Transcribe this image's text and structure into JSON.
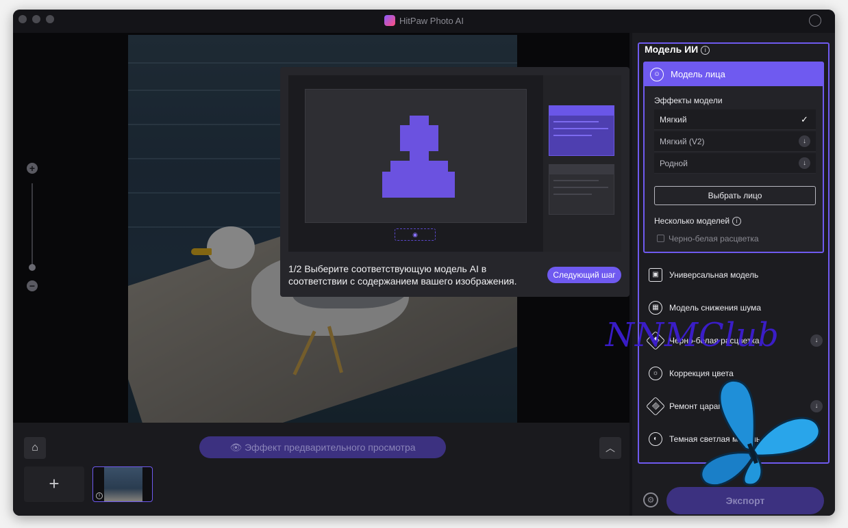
{
  "app": {
    "title": "HitPaw Photo AI"
  },
  "tour": {
    "text": "1/2 Выберите соответствующую модель AI в соответствии с содержанием вашего изображения.",
    "next_label": "Следующий шаг"
  },
  "bottom": {
    "preview_effect": "Эффект предварительного просмотра",
    "add": "+"
  },
  "panel": {
    "section_title": "Модель ИИ",
    "face_model": {
      "title": "Модель лица",
      "effects_label": "Эффекты модели",
      "options": [
        {
          "label": "Мягкий",
          "state": "selected"
        },
        {
          "label": "Мягкий (V2)",
          "state": "download"
        },
        {
          "label": "Родной",
          "state": "download"
        }
      ],
      "choose_face": "Выбрать лицо",
      "multi_label": "Несколько моделей",
      "bw_checkbox": "Черно-белая расцветка"
    },
    "models": [
      {
        "label": "Универсальная модель",
        "icon": "image-icon",
        "download": false
      },
      {
        "label": "Модель снижения шума",
        "icon": "noise-icon",
        "download": false
      },
      {
        "label": "Черно-белая расцветка",
        "icon": "colorize-icon",
        "download": true
      },
      {
        "label": "Коррекция цвета",
        "icon": "sun-icon",
        "download": false
      },
      {
        "label": "Ремонт царапин",
        "icon": "bandage-icon",
        "download": true
      },
      {
        "label": "Темная светлая модель",
        "icon": "contrast-icon",
        "download": false
      }
    ],
    "export_label": "Экспорт"
  },
  "watermark": "NNMClub",
  "colors": {
    "accent": "#6f5af0",
    "background": "#141418",
    "panel": "#1c1c20"
  }
}
